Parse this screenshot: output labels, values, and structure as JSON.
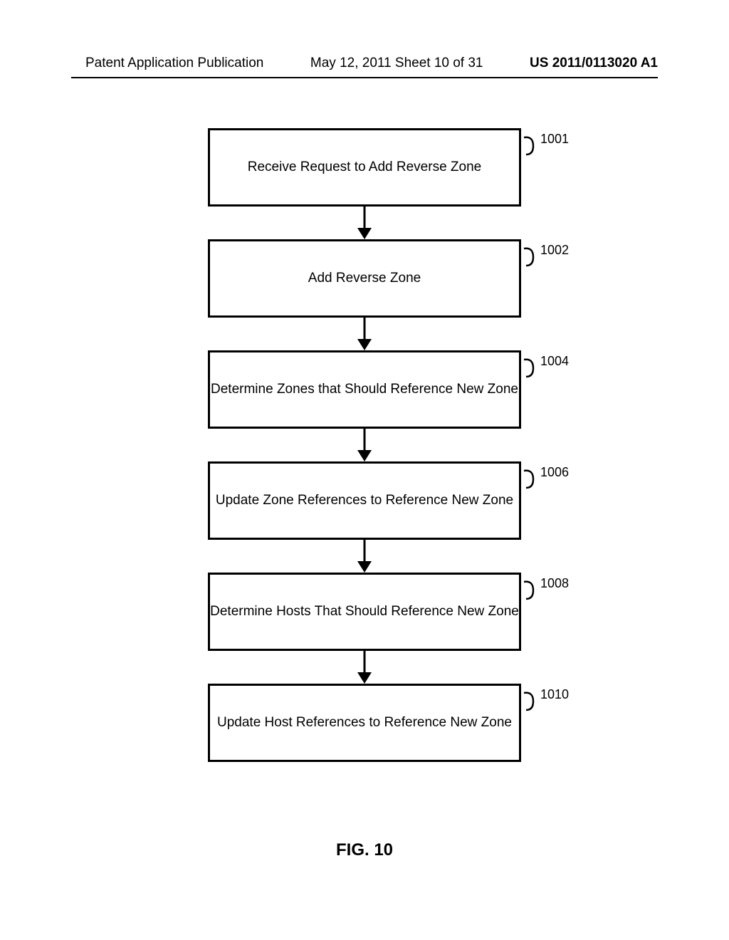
{
  "header": {
    "left": "Patent Application Publication",
    "center": "May 12, 2011  Sheet 10 of 31",
    "right": "US 2011/0113020 A1"
  },
  "flow": {
    "nodes": [
      {
        "text": "Receive Request to Add Reverse Zone",
        "ref": "1001"
      },
      {
        "text": "Add Reverse Zone",
        "ref": "1002"
      },
      {
        "text": "Determine Zones that Should Reference New Zone",
        "ref": "1004"
      },
      {
        "text": "Update Zone References to Reference New Zone",
        "ref": "1006"
      },
      {
        "text": "Determine Hosts That Should Reference New Zone",
        "ref": "1008"
      },
      {
        "text": "Update Host References to Reference New Zone",
        "ref": "1010"
      }
    ]
  },
  "figure_label": "FIG. 10"
}
